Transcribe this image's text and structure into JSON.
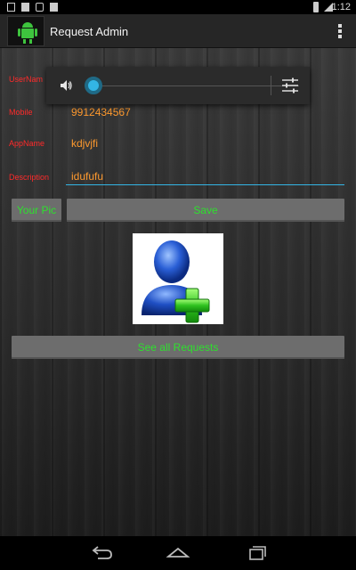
{
  "status_bar": {
    "time": "1:12",
    "icons": [
      "image-icon",
      "sd-card-icon",
      "lock-icon",
      "check-icon",
      "signal-icon",
      "battery-icon"
    ]
  },
  "action_bar": {
    "title": "Request Admin",
    "app_icon": "android-robot-icon",
    "menu_icon": "overflow-menu-icon"
  },
  "form": {
    "username_label": "UserNam",
    "mobile_label": "Mobile",
    "mobile_value": "9912434567",
    "appname_label": "AppName",
    "appname_value": "kdjvjfi",
    "description_label": "Description",
    "description_value": "idufufu"
  },
  "buttons": {
    "your_pic": "Your Pic",
    "save": "Save",
    "see_all": "See all Requests"
  },
  "picture": {
    "icon": "add-user-icon"
  },
  "volume_popup": {
    "level": 0,
    "speaker_icon": "speaker-icon",
    "settings_icon": "sliders-icon"
  },
  "colors": {
    "label": "#ff2a2a",
    "value": "#ff9a2e",
    "button_text": "#2ee02e",
    "button_bg": "#6d6d6d",
    "accent": "#33b5e5"
  },
  "nav_bar": {
    "icons": [
      "back-icon",
      "home-icon",
      "recent-apps-icon"
    ]
  }
}
